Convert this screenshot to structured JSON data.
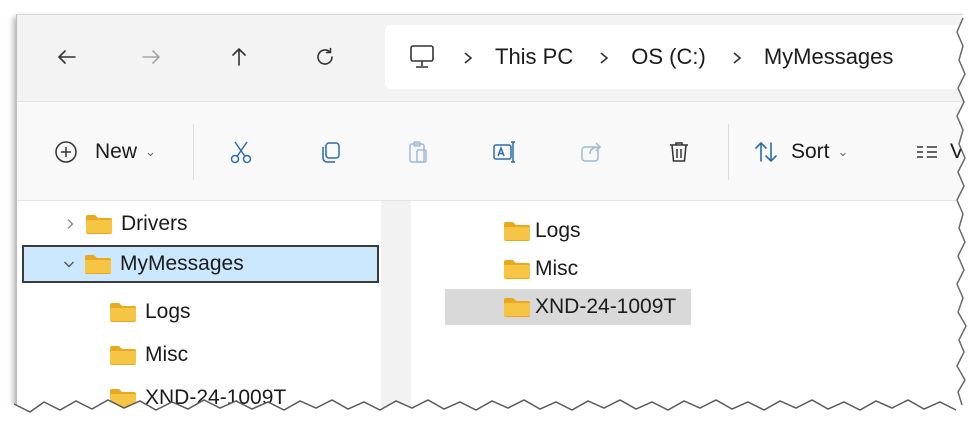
{
  "navigation": {
    "back": "back-arrow-icon",
    "forward": "forward-arrow-icon",
    "up": "up-arrow-icon",
    "refresh": "refresh-icon"
  },
  "breadcrumb": {
    "icon": "computer-icon",
    "items": [
      "This PC",
      "OS (C:)",
      "MyMessages"
    ]
  },
  "toolbar": {
    "new_label": "New",
    "sort_label": "Sort",
    "view_label": "V",
    "icons": [
      "plus-circle-icon",
      "cut-icon",
      "copy-icon",
      "paste-icon",
      "rename-icon",
      "share-icon",
      "delete-icon",
      "sort-icon",
      "view-icon"
    ]
  },
  "nav_pane": {
    "items": [
      {
        "label": "Drivers",
        "expanded": false,
        "level": 0
      },
      {
        "label": "MyMessages",
        "expanded": true,
        "level": 0,
        "selected": true
      },
      {
        "label": "Logs",
        "level": 1
      },
      {
        "label": "Misc",
        "level": 1
      },
      {
        "label": "XND-24-1009T",
        "level": 1
      }
    ]
  },
  "content": {
    "items": [
      {
        "label": "Logs"
      },
      {
        "label": "Misc"
      },
      {
        "label": "XND-24-1009T",
        "highlighted": true
      }
    ]
  },
  "colors": {
    "folder": "#f4c43a",
    "selection": "#cce8ff",
    "hover": "#d9d9d9"
  }
}
